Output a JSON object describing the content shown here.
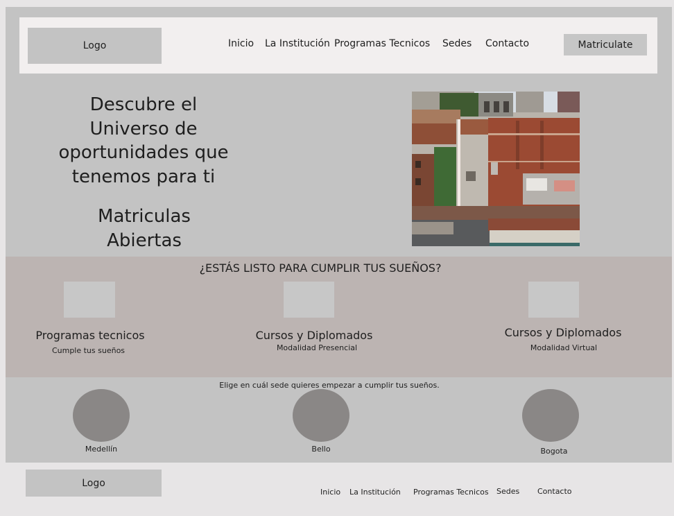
{
  "header": {
    "logo": "Logo",
    "nav": [
      "Inicio",
      "La Institución",
      "Programas Tecnicos",
      "Sedes",
      "Contacto"
    ],
    "cta": "Matriculate"
  },
  "hero": {
    "headline": "Descubre el Universo de oportunidades que tenemos para ti",
    "subheadline": "Matriculas Abiertas"
  },
  "programs": {
    "title": "¿ESTÁS LISTO PARA CUMPLIR TUS SUEÑOS?",
    "cards": [
      {
        "title": "Programas tecnicos",
        "subtitle": "Cumple tus sueños"
      },
      {
        "title": "Cursos y Diplomados",
        "subtitle": "Modalidad Presencial"
      },
      {
        "title": "Cursos y Diplomados",
        "subtitle": "Modalidad Virtual"
      }
    ]
  },
  "campuses": {
    "intro": "Elige en cuál sede quieres empezar a cumplir tus sueños.",
    "cities": [
      "Medellín",
      "Bello",
      "Bogota"
    ]
  },
  "footer": {
    "logo": "Logo",
    "nav": [
      "Inicio",
      "La Institución",
      "Programas Tecnicos",
      "Sedes",
      "Contacto"
    ]
  }
}
